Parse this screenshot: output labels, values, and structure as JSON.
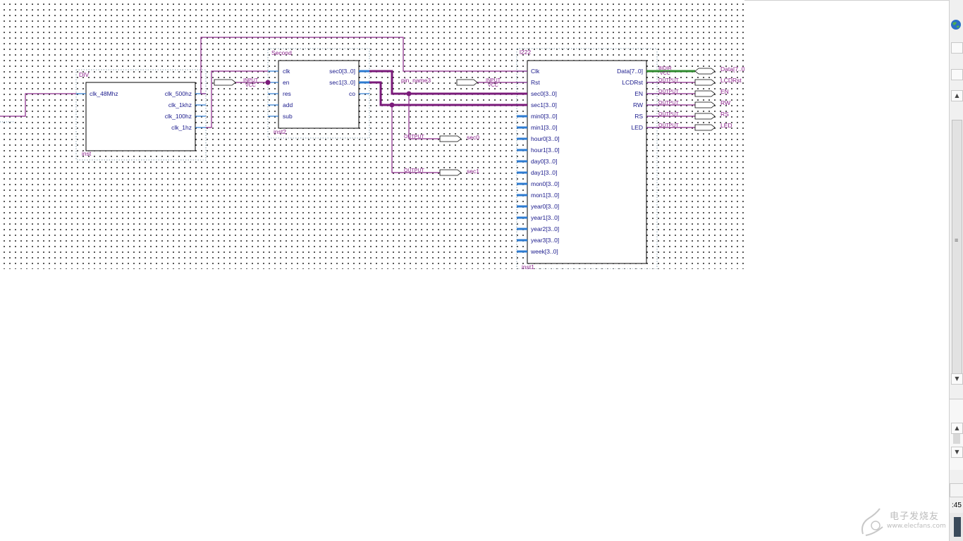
{
  "blocks": {
    "div": {
      "type_label": "DIV",
      "inst": "inst",
      "in_ports": [
        "clk_48Mhz"
      ],
      "out_ports": [
        "clk_500hz",
        "clk_1khz",
        "clk_100hz",
        "clk_1hz"
      ]
    },
    "second": {
      "type_label": "Second",
      "inst": "inst2",
      "in_ports": [
        "clk",
        "en",
        "res",
        "add",
        "sub"
      ],
      "out_ports": [
        "sec0[3..0]",
        "sec1[3..0]",
        "co"
      ]
    },
    "lcd": {
      "type_label": "l222",
      "inst": "inst1",
      "in_ports": [
        "Clk",
        "Rst",
        "sec0[3..0]",
        "sec1[3..0]",
        "min0[3..0]",
        "min1[3..0]",
        "hour0[3..0]",
        "hour1[3..0]",
        "day0[3..0]",
        "day1[3..0]",
        "mon0[3..0]",
        "mon1[3..0]",
        "year0[3..0]",
        "year1[3..0]",
        "year2[3..0]",
        "year3[3..0]",
        "week[3..0]"
      ],
      "out_ports": [
        "Data[7..0]",
        "LCDRst",
        "EN",
        "RW",
        "RS",
        "LED"
      ]
    }
  },
  "io": {
    "en_input": {
      "kind": "INPUT",
      "vcc": "VCC"
    },
    "rst_input": {
      "kind": "INPUT",
      "vcc": "VCC",
      "pin_name": "pin_name3"
    },
    "sec0_output": {
      "kind": "OUTPUT",
      "name": "sec0"
    },
    "sec1_output": {
      "kind": "OUTPUT",
      "name": "sec1"
    },
    "data_bidir": {
      "kind": "BIDIR",
      "vcc": "VCC",
      "name": "Data[7..0]"
    },
    "outputs": [
      {
        "kind": "OUTPUT",
        "name": "LCDRst"
      },
      {
        "kind": "OUTPUT",
        "name": "EN"
      },
      {
        "kind": "OUTPUT",
        "name": "RW"
      },
      {
        "kind": "OUTPUT",
        "name": "RS"
      },
      {
        "kind": "OUTPUT",
        "name": "LED"
      }
    ]
  },
  "status": {
    "time_fragment": ":45"
  },
  "watermark": {
    "text": "电子发烧友",
    "url": "www.elecfans.com"
  },
  "colors": {
    "wire": "#8a2a8a",
    "pin": "#2d7bd1",
    "bidir": "#2e8a2e",
    "text": "#1a1a8c"
  }
}
